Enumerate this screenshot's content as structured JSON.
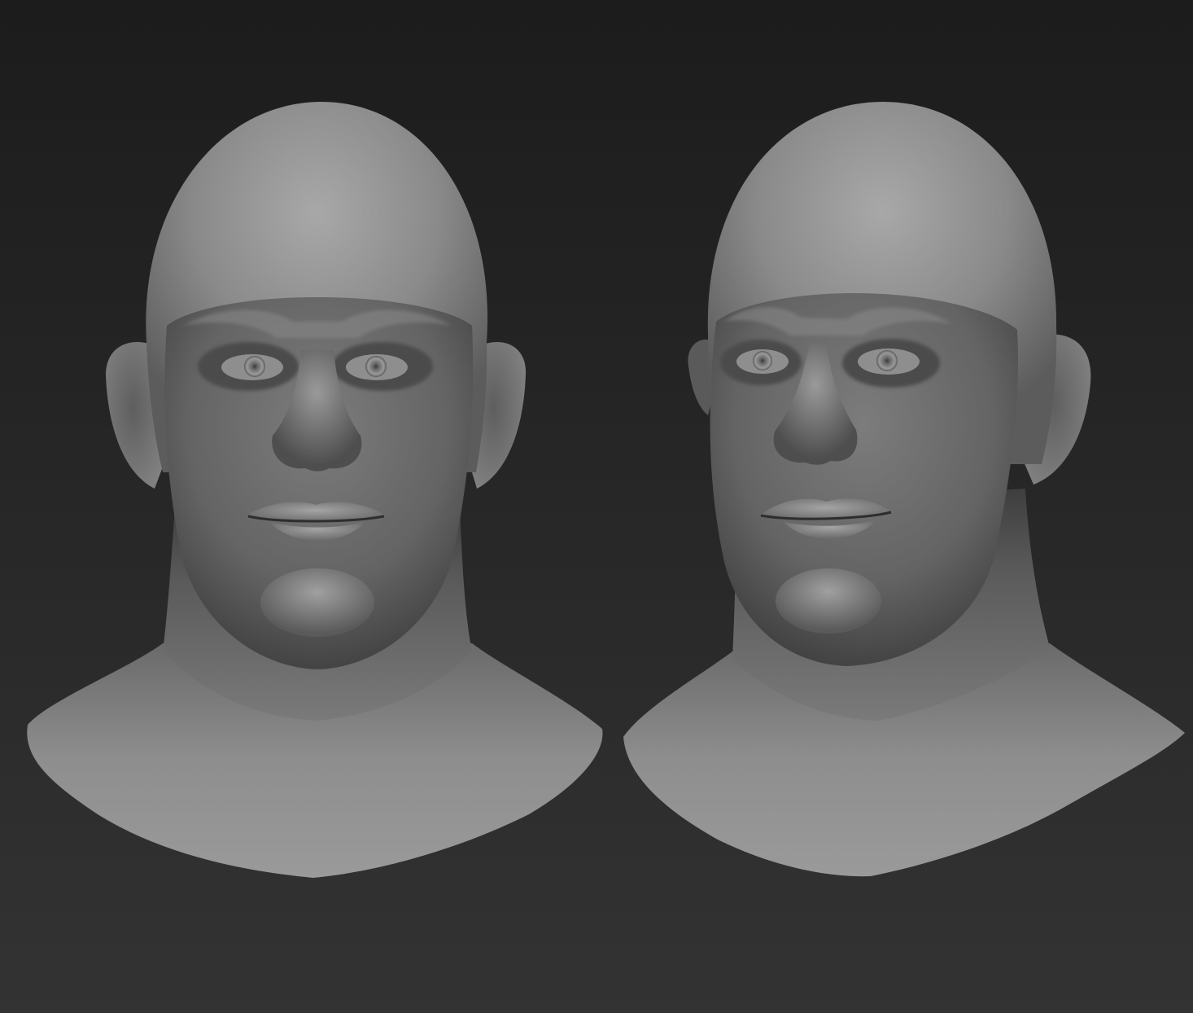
{
  "scene": {
    "background_top": "#1c1c1c",
    "background_bottom": "#333333",
    "clay_color": "#8c8c8c",
    "views": [
      {
        "id": "front",
        "view": "front"
      },
      {
        "id": "three-quarter",
        "view": "three-quarter"
      }
    ]
  }
}
